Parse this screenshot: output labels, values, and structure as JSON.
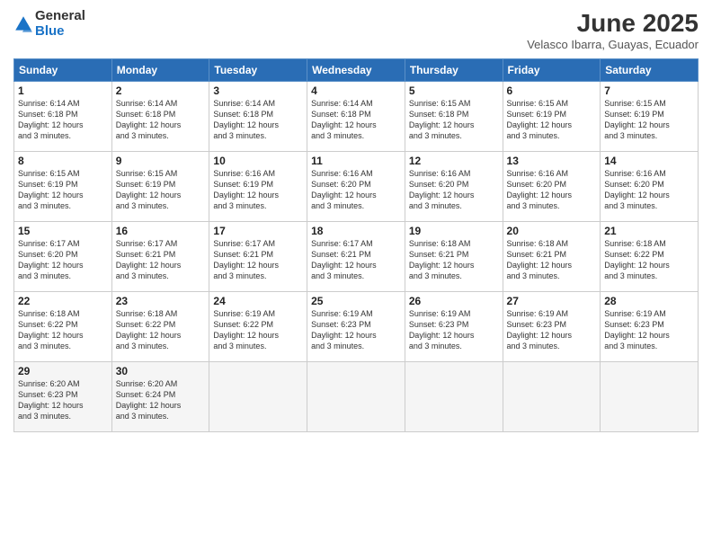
{
  "logo": {
    "general": "General",
    "blue": "Blue"
  },
  "title": "June 2025",
  "subtitle": "Velasco Ibarra, Guayas, Ecuador",
  "days_header": [
    "Sunday",
    "Monday",
    "Tuesday",
    "Wednesday",
    "Thursday",
    "Friday",
    "Saturday"
  ],
  "weeks": [
    [
      {
        "num": "1",
        "info": "Sunrise: 6:14 AM\nSunset: 6:18 PM\nDaylight: 12 hours\nand 3 minutes."
      },
      {
        "num": "2",
        "info": "Sunrise: 6:14 AM\nSunset: 6:18 PM\nDaylight: 12 hours\nand 3 minutes."
      },
      {
        "num": "3",
        "info": "Sunrise: 6:14 AM\nSunset: 6:18 PM\nDaylight: 12 hours\nand 3 minutes."
      },
      {
        "num": "4",
        "info": "Sunrise: 6:14 AM\nSunset: 6:18 PM\nDaylight: 12 hours\nand 3 minutes."
      },
      {
        "num": "5",
        "info": "Sunrise: 6:15 AM\nSunset: 6:18 PM\nDaylight: 12 hours\nand 3 minutes."
      },
      {
        "num": "6",
        "info": "Sunrise: 6:15 AM\nSunset: 6:19 PM\nDaylight: 12 hours\nand 3 minutes."
      },
      {
        "num": "7",
        "info": "Sunrise: 6:15 AM\nSunset: 6:19 PM\nDaylight: 12 hours\nand 3 minutes."
      }
    ],
    [
      {
        "num": "8",
        "info": "Sunrise: 6:15 AM\nSunset: 6:19 PM\nDaylight: 12 hours\nand 3 minutes."
      },
      {
        "num": "9",
        "info": "Sunrise: 6:15 AM\nSunset: 6:19 PM\nDaylight: 12 hours\nand 3 minutes."
      },
      {
        "num": "10",
        "info": "Sunrise: 6:16 AM\nSunset: 6:19 PM\nDaylight: 12 hours\nand 3 minutes."
      },
      {
        "num": "11",
        "info": "Sunrise: 6:16 AM\nSunset: 6:20 PM\nDaylight: 12 hours\nand 3 minutes."
      },
      {
        "num": "12",
        "info": "Sunrise: 6:16 AM\nSunset: 6:20 PM\nDaylight: 12 hours\nand 3 minutes."
      },
      {
        "num": "13",
        "info": "Sunrise: 6:16 AM\nSunset: 6:20 PM\nDaylight: 12 hours\nand 3 minutes."
      },
      {
        "num": "14",
        "info": "Sunrise: 6:16 AM\nSunset: 6:20 PM\nDaylight: 12 hours\nand 3 minutes."
      }
    ],
    [
      {
        "num": "15",
        "info": "Sunrise: 6:17 AM\nSunset: 6:20 PM\nDaylight: 12 hours\nand 3 minutes."
      },
      {
        "num": "16",
        "info": "Sunrise: 6:17 AM\nSunset: 6:21 PM\nDaylight: 12 hours\nand 3 minutes."
      },
      {
        "num": "17",
        "info": "Sunrise: 6:17 AM\nSunset: 6:21 PM\nDaylight: 12 hours\nand 3 minutes."
      },
      {
        "num": "18",
        "info": "Sunrise: 6:17 AM\nSunset: 6:21 PM\nDaylight: 12 hours\nand 3 minutes."
      },
      {
        "num": "19",
        "info": "Sunrise: 6:18 AM\nSunset: 6:21 PM\nDaylight: 12 hours\nand 3 minutes."
      },
      {
        "num": "20",
        "info": "Sunrise: 6:18 AM\nSunset: 6:21 PM\nDaylight: 12 hours\nand 3 minutes."
      },
      {
        "num": "21",
        "info": "Sunrise: 6:18 AM\nSunset: 6:22 PM\nDaylight: 12 hours\nand 3 minutes."
      }
    ],
    [
      {
        "num": "22",
        "info": "Sunrise: 6:18 AM\nSunset: 6:22 PM\nDaylight: 12 hours\nand 3 minutes."
      },
      {
        "num": "23",
        "info": "Sunrise: 6:18 AM\nSunset: 6:22 PM\nDaylight: 12 hours\nand 3 minutes."
      },
      {
        "num": "24",
        "info": "Sunrise: 6:19 AM\nSunset: 6:22 PM\nDaylight: 12 hours\nand 3 minutes."
      },
      {
        "num": "25",
        "info": "Sunrise: 6:19 AM\nSunset: 6:23 PM\nDaylight: 12 hours\nand 3 minutes."
      },
      {
        "num": "26",
        "info": "Sunrise: 6:19 AM\nSunset: 6:23 PM\nDaylight: 12 hours\nand 3 minutes."
      },
      {
        "num": "27",
        "info": "Sunrise: 6:19 AM\nSunset: 6:23 PM\nDaylight: 12 hours\nand 3 minutes."
      },
      {
        "num": "28",
        "info": "Sunrise: 6:19 AM\nSunset: 6:23 PM\nDaylight: 12 hours\nand 3 minutes."
      }
    ],
    [
      {
        "num": "29",
        "info": "Sunrise: 6:20 AM\nSunset: 6:23 PM\nDaylight: 12 hours\nand 3 minutes."
      },
      {
        "num": "30",
        "info": "Sunrise: 6:20 AM\nSunset: 6:24 PM\nDaylight: 12 hours\nand 3 minutes."
      },
      {
        "num": "",
        "info": ""
      },
      {
        "num": "",
        "info": ""
      },
      {
        "num": "",
        "info": ""
      },
      {
        "num": "",
        "info": ""
      },
      {
        "num": "",
        "info": ""
      }
    ]
  ]
}
